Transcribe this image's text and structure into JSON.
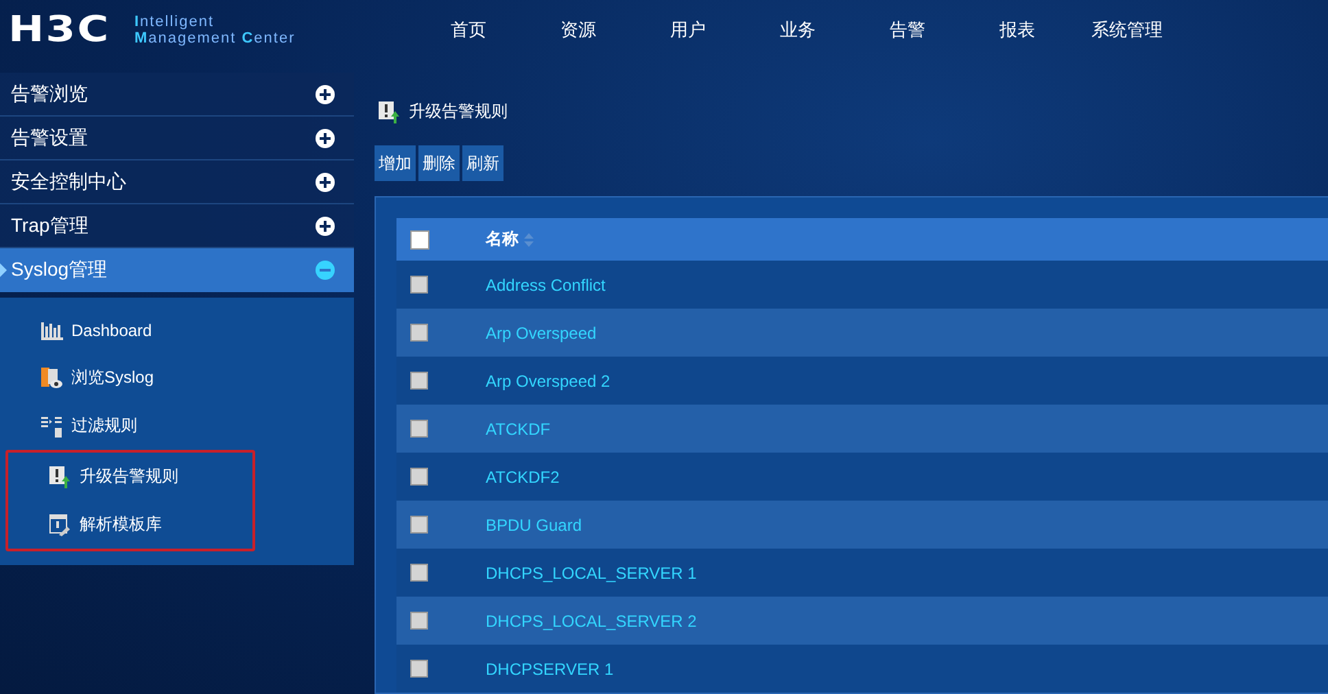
{
  "logo": {
    "brand": "H3C",
    "line_1": [
      {
        "text": "I",
        "accent": true
      },
      {
        "text": "ntelligent",
        "accent": false
      }
    ],
    "line_2": [
      {
        "text": "M",
        "accent": true
      },
      {
        "text": "anagement ",
        "accent": false
      },
      {
        "text": "C",
        "accent": true
      },
      {
        "text": "enter",
        "accent": false
      }
    ]
  },
  "nav": [
    "首页",
    "资源",
    "用户",
    "业务",
    "告警",
    "报表",
    "系统管理"
  ],
  "sidebar": {
    "items": [
      {
        "label": "告警浏览",
        "expanded": false
      },
      {
        "label": "告警设置",
        "expanded": false
      },
      {
        "label": "安全控制中心",
        "expanded": false
      },
      {
        "label": "Trap管理",
        "expanded": false
      },
      {
        "label": "Syslog管理",
        "expanded": true,
        "children": [
          {
            "label": "Dashboard",
            "kind": "chart",
            "highlighted": false
          },
          {
            "label": "浏览Syslog",
            "kind": "view",
            "highlighted": false
          },
          {
            "label": "过滤规则",
            "kind": "filter",
            "highlighted": false
          },
          {
            "label": "升级告警规则",
            "kind": "upgrade",
            "highlighted": true
          },
          {
            "label": "解析模板库",
            "kind": "template",
            "highlighted": true
          }
        ]
      }
    ]
  },
  "page_title": "升级告警规则",
  "toolbar": [
    "增加",
    "删除",
    "刷新"
  ],
  "table": {
    "header_checked": false,
    "columns": [
      "名称"
    ],
    "rows": [
      {
        "name": "Address Conflict",
        "checked": false
      },
      {
        "name": "Arp Overspeed",
        "checked": false
      },
      {
        "name": "Arp Overspeed 2",
        "checked": false
      },
      {
        "name": "ATCKDF",
        "checked": false
      },
      {
        "name": "ATCKDF2",
        "checked": false
      },
      {
        "name": "BPDU Guard",
        "checked": false
      },
      {
        "name": "DHCPS_LOCAL_SERVER 1",
        "checked": false
      },
      {
        "name": "DHCPS_LOCAL_SERVER 2",
        "checked": false
      },
      {
        "name": "DHCPSERVER 1",
        "checked": false
      }
    ]
  }
}
